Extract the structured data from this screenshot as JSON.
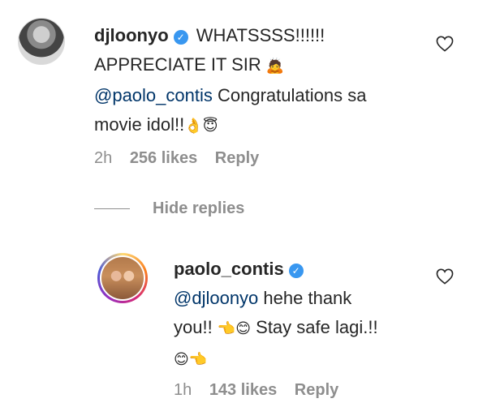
{
  "comment": {
    "username": "djloonyo",
    "line1": "WHATSSSS!!!!!!",
    "line2": "APPRECIATE IT SIR",
    "mention": "@paolo_contis",
    "line3_rest": "Congratulations sa",
    "line4": "movie idol!!",
    "emoji_bow": "🙇",
    "emoji_hand": "👌",
    "emoji_angel": "😇",
    "time": "2h",
    "likes": "256 likes",
    "reply_label": "Reply"
  },
  "hide_replies_label": "Hide replies",
  "reply": {
    "username": "paolo_contis",
    "mention": "@djloonyo",
    "text1": "hehe thank",
    "text2a": "you!!",
    "text2b": "Stay safe lagi.!!",
    "emoji_point": "👈",
    "emoji_smile": "😊",
    "time": "1h",
    "likes": "143 likes",
    "reply_label": "Reply"
  },
  "colors": {
    "verified": "#3897f0",
    "mention": "#003569",
    "meta": "#8e8e8e"
  }
}
